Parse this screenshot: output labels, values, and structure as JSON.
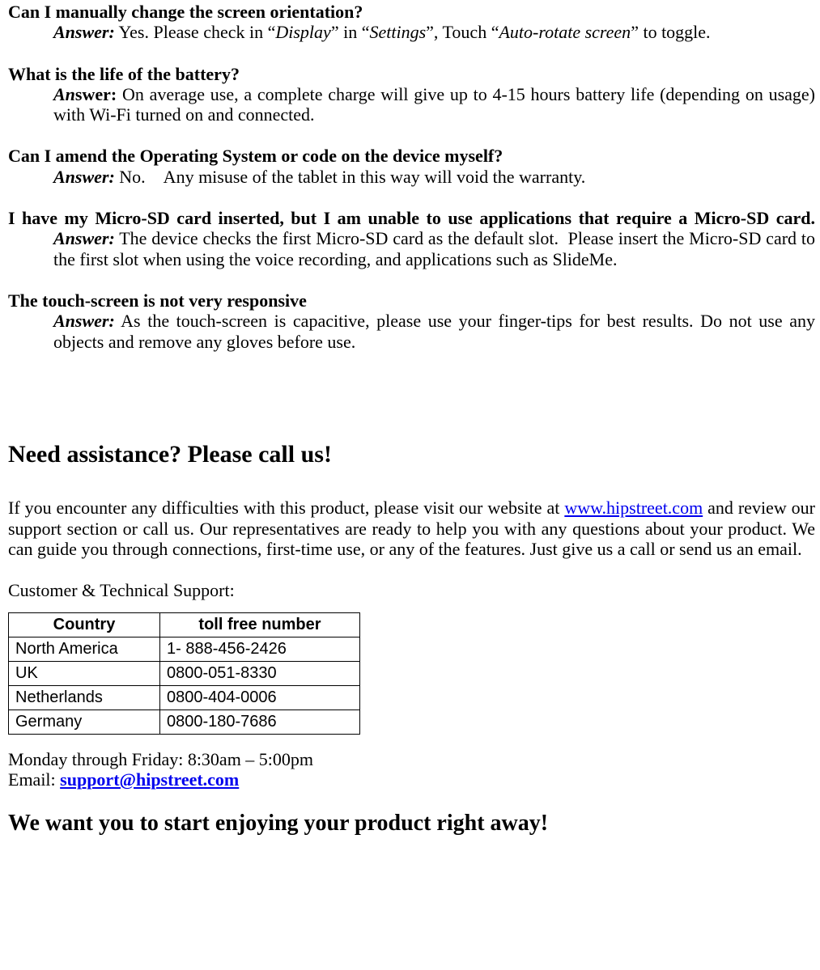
{
  "faq": [
    {
      "q": "Can I manually change the screen orientation?",
      "q_justify": false,
      "answer_label": "Answer:",
      "answer_label_italic": true,
      "answer_parts": [
        {
          "t": " Yes. Please check in “"
        },
        {
          "t": "Display",
          "italic": true
        },
        {
          "t": "” in “"
        },
        {
          "t": "Settings",
          "italic": true
        },
        {
          "t": "”, Touch “"
        },
        {
          "t": "Auto-rotate screen",
          "italic": true
        },
        {
          "t": "” to toggle."
        }
      ],
      "answer_justify_all": false
    },
    {
      "q": "What is the life of the battery?",
      "q_justify": false,
      "answer_label": "Answer:",
      "answer_label_partial_italic": "An",
      "answer_label_rest": "swer:",
      "answer_parts": [
        {
          "t": " On average use, a complete charge will give up to 4-15 hours battery life (depending on usage) with Wi-Fi turned on and connected."
        }
      ],
      "answer_justify_all": false
    },
    {
      "q": "Can I amend the Operating System or code on the device myself?",
      "q_justify": false,
      "answer_label": "Answer:",
      "answer_label_italic": true,
      "answer_parts": [
        {
          "t": " No. Any misuse of the tablet in this way will void the warranty."
        }
      ],
      "answer_justify_all": false
    },
    {
      "q": "I have my Micro-SD card inserted, but I am unable to use applications that require a Micro-SD card.",
      "q_justify": true,
      "answer_label": "Answer:",
      "answer_label_italic": true,
      "answer_parts": [
        {
          "t": " The device checks the first Micro-SD card as the default slot.  Please insert the Micro-SD card to the first slot when using the voice recording, and applications such as SlideMe."
        }
      ],
      "answer_justify_all": false
    },
    {
      "q": "The touch-screen is not very responsive",
      "q_justify": false,
      "answer_label": "Answer:",
      "answer_label_italic": true,
      "answer_parts": [
        {
          "t": " As the touch-screen is capacitive, please use your finger-tips for best results. Do not use any objects and remove any gloves before use."
        }
      ],
      "answer_justify_all": false
    }
  ],
  "assist": {
    "heading": "Need assistance? Please call us!",
    "para_before_link": "If you encounter any difficulties with this product, please visit our website at ",
    "website": "www.hipstreet.com",
    "para_after_link": " and review our support section or call us. Our representatives are ready to help you with any questions about your product. We can guide you through connections, first-time use, or any of the features. Just give us a call or send us an email.",
    "support_label": "Customer & Technical Support:",
    "table": {
      "headers": [
        "Country",
        "toll free number"
      ],
      "rows": [
        [
          "North America",
          "1- 888-456-2426"
        ],
        [
          "UK",
          "0800-051-8330"
        ],
        [
          "Netherlands",
          "0800-404-0006"
        ],
        [
          "Germany",
          "0800-180-7686"
        ]
      ]
    },
    "hours": "Monday through Friday: 8:30am – 5:00pm",
    "email_label": "Email: ",
    "email": "support@hipstreet.com",
    "closing": "We want you to start enjoying your product right away!"
  }
}
